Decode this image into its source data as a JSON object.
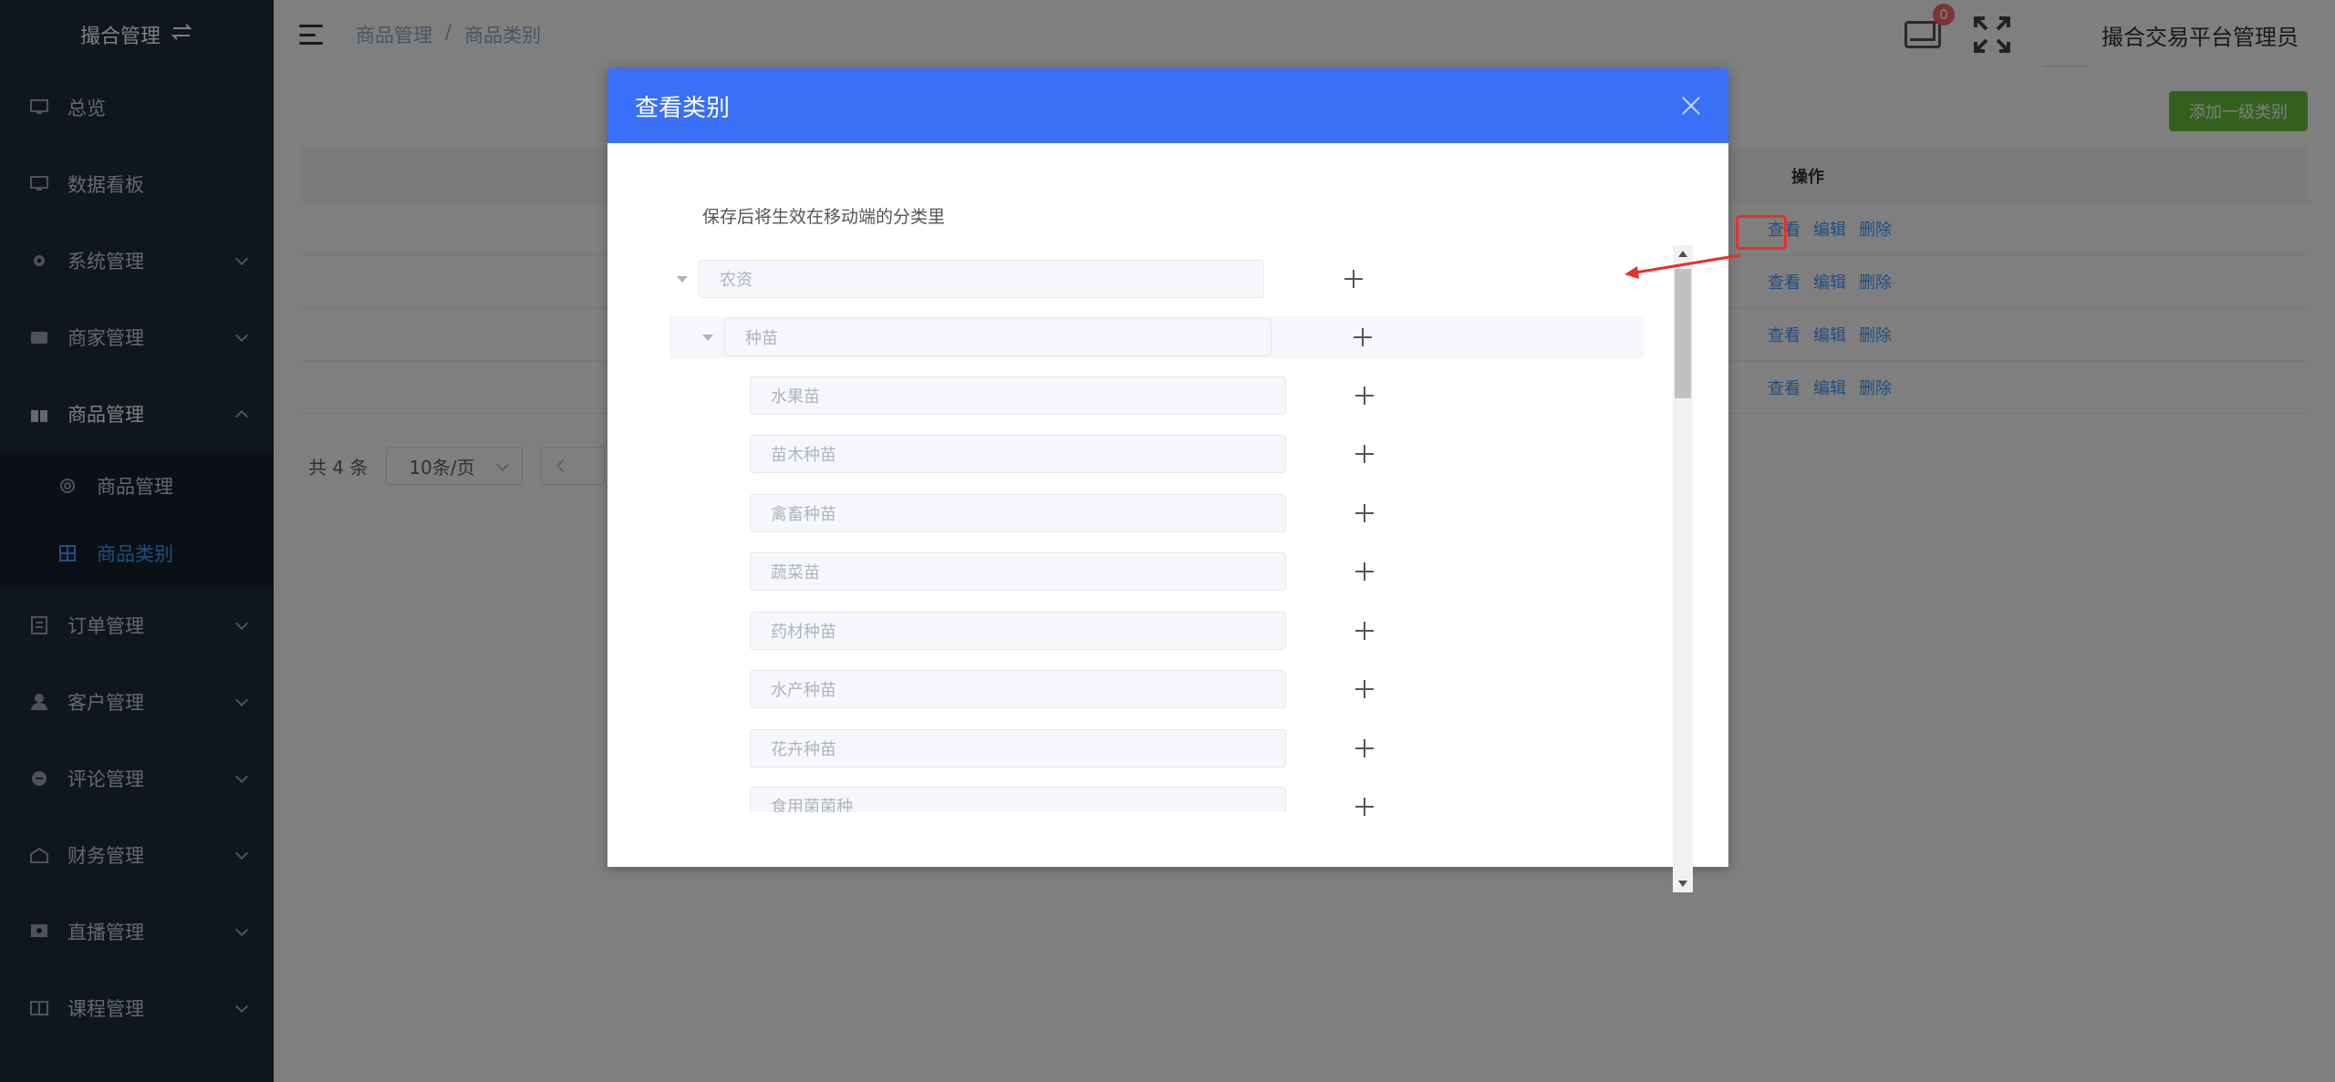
{
  "sidebar": {
    "brand": "撮合管理",
    "items": [
      {
        "label": "总览",
        "icon": "monitor-icon",
        "has_children": false
      },
      {
        "label": "数据看板",
        "icon": "monitor-icon",
        "has_children": false
      },
      {
        "label": "系统管理",
        "icon": "gear-icon",
        "has_children": true
      },
      {
        "label": "商家管理",
        "icon": "store-icon",
        "has_children": true
      },
      {
        "label": "商品管理",
        "icon": "gift-icon",
        "has_children": true,
        "expanded": true
      }
    ],
    "sub_items": [
      {
        "label": "商品管理",
        "icon": "cog-icon",
        "active": false
      },
      {
        "label": "商品类别",
        "icon": "grid-icon",
        "active": true
      }
    ],
    "items_after": [
      {
        "label": "订单管理",
        "icon": "document-icon"
      },
      {
        "label": "客户管理",
        "icon": "user-icon"
      },
      {
        "label": "评论管理",
        "icon": "comment-icon"
      },
      {
        "label": "财务管理",
        "icon": "wallet-icon"
      },
      {
        "label": "直播管理",
        "icon": "live-icon"
      },
      {
        "label": "课程管理",
        "icon": "book-icon"
      }
    ]
  },
  "header": {
    "breadcrumb": [
      "商品管理",
      "/",
      "商品类别"
    ],
    "mail_badge": "0",
    "username": "撮合交易平台管理员"
  },
  "main": {
    "add_button": "添加一级类别",
    "op_header": "操作",
    "row_ops": [
      [
        "查看",
        "编辑",
        "删除"
      ],
      [
        "查看",
        "编辑",
        "删除"
      ],
      [
        "查看",
        "编辑",
        "删除"
      ],
      [
        "查看",
        "编辑",
        "删除"
      ]
    ],
    "pagination": {
      "total": "共 4 条",
      "page_size": "10条/页"
    }
  },
  "dialog": {
    "title": "查看类别",
    "hint": "保存后将生效在移动端的分类里",
    "root": "农资",
    "level2": "种苗",
    "children": [
      "水果苗",
      "苗木种苗",
      "禽畜种苗",
      "蔬菜苗",
      "药材种苗",
      "水产种苗",
      "花卉种苗",
      "食用菌菌种"
    ]
  },
  "colors": {
    "sidebar_bg": "#1f2d3d",
    "dialog_header": "#3a6ff7",
    "link": "#409eff",
    "add_button": "#67c23a",
    "annotation_red": "#e8302a"
  }
}
